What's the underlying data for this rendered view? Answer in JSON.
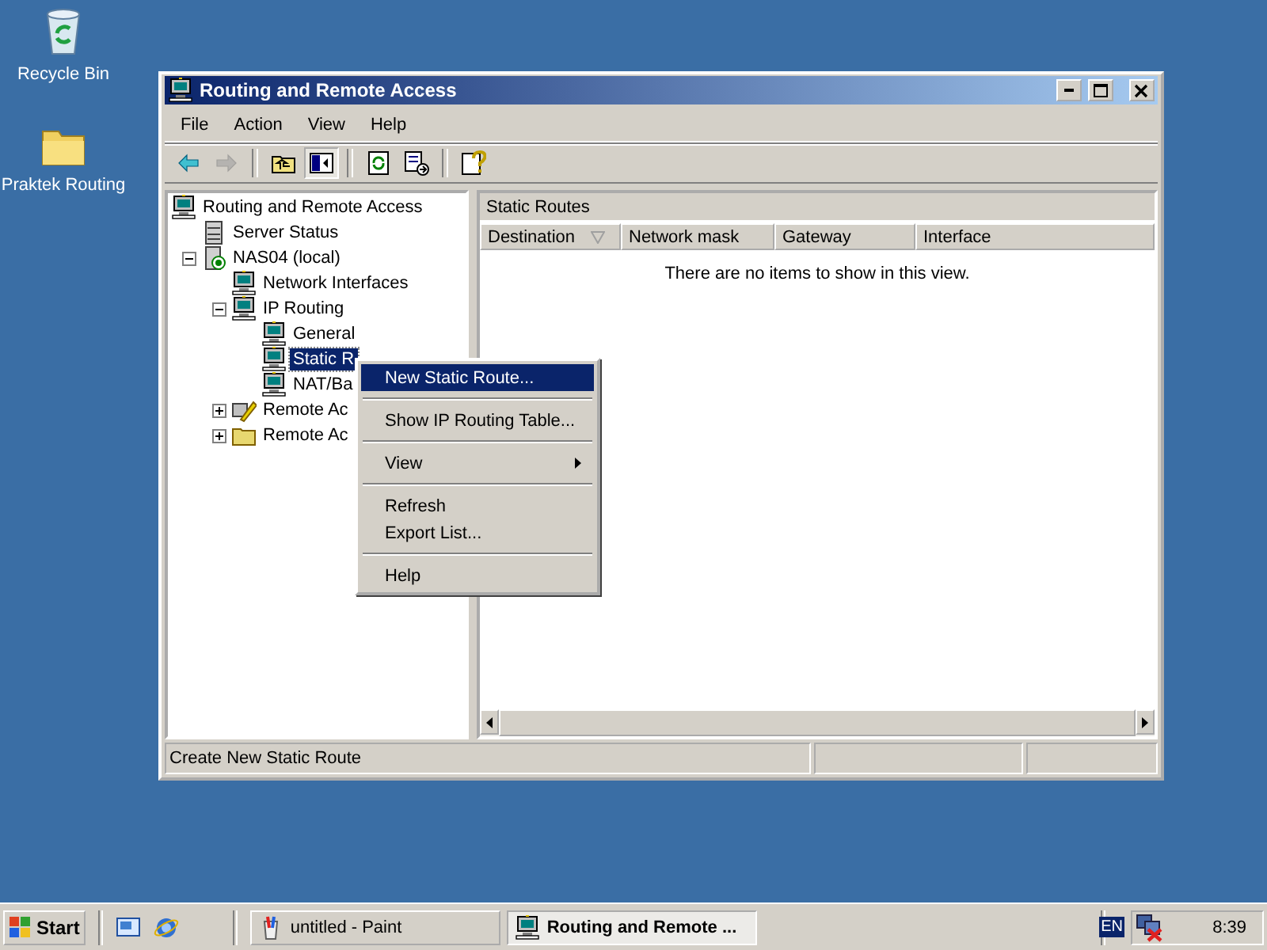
{
  "desktop_icons": [
    {
      "label": "Recycle Bin",
      "kind": "recycle-bin"
    },
    {
      "label": "Praktek Routing",
      "kind": "folder"
    }
  ],
  "window": {
    "title": "Routing and Remote Access",
    "active": true
  },
  "menu_bar": [
    "File",
    "Action",
    "View",
    "Help"
  ],
  "toolbar": [
    {
      "kind": "back",
      "disabled": false,
      "pressed": false
    },
    {
      "kind": "forward",
      "disabled": true,
      "pressed": false
    },
    {
      "kind": "separator"
    },
    {
      "kind": "up",
      "disabled": false,
      "pressed": false
    },
    {
      "kind": "tree",
      "disabled": false,
      "pressed": true
    },
    {
      "kind": "separator"
    },
    {
      "kind": "refresh",
      "disabled": false,
      "pressed": false
    },
    {
      "kind": "export",
      "disabled": false,
      "pressed": false
    },
    {
      "kind": "separator"
    },
    {
      "kind": "help",
      "disabled": false,
      "pressed": false
    }
  ],
  "tree": [
    {
      "label": "Routing and Remote Access",
      "kind": "computer",
      "selected": false,
      "children": [
        {
          "label": "Server Status",
          "kind": "server",
          "selected": false
        },
        {
          "label": "NAS04 (local)",
          "kind": "local-server",
          "selected": false,
          "expanded": true,
          "children": [
            {
              "label": "Network Interfaces",
              "kind": "computer",
              "selected": false
            },
            {
              "label": "IP Routing",
              "kind": "computer",
              "selected": false,
              "expanded": true,
              "children": [
                {
                  "label": "General",
                  "kind": "computer",
                  "selected": false
                },
                {
                  "label": "Static R",
                  "kind": "computer",
                  "selected": true
                },
                {
                  "label": "NAT/Ba",
                  "kind": "computer",
                  "selected": false
                }
              ]
            },
            {
              "label": "Remote Ac",
              "kind": "policy",
              "selected": false,
              "expanded": false
            },
            {
              "label": "Remote Ac",
              "kind": "folder",
              "selected": false,
              "expanded": false
            }
          ]
        }
      ]
    }
  ],
  "list_view": {
    "title": "Static Routes",
    "columns": [
      {
        "label": "Destination",
        "sorted": true
      },
      {
        "label": "Network mask",
        "sorted": false
      },
      {
        "label": "Gateway",
        "sorted": false
      },
      {
        "label": "Interface",
        "sorted": false
      }
    ],
    "empty_message": "There are no items to show in this view."
  },
  "status_bar": {
    "text": "Create New Static Route"
  },
  "context_menu": [
    {
      "kind": "item",
      "label": "New Static Route...",
      "selected": true
    },
    {
      "kind": "separator"
    },
    {
      "kind": "item",
      "label": "Show IP Routing Table...",
      "selected": false
    },
    {
      "kind": "separator"
    },
    {
      "kind": "submenu",
      "label": "View",
      "selected": false
    },
    {
      "kind": "separator"
    },
    {
      "kind": "item",
      "label": "Refresh",
      "selected": false
    },
    {
      "kind": "item",
      "label": "Export List...",
      "selected": false
    },
    {
      "kind": "separator"
    },
    {
      "kind": "item",
      "label": "Help",
      "selected": false
    }
  ],
  "taskbar": {
    "start": "Start",
    "quick_launch": [
      {
        "kind": "desktop"
      },
      {
        "kind": "browser"
      }
    ],
    "tasks": [
      {
        "label": "untitled - Paint",
        "kind": "paint",
        "selected": false
      },
      {
        "label": "Routing and Remote ...",
        "kind": "computer",
        "selected": true
      }
    ],
    "language": "EN",
    "clock": "8:39"
  }
}
